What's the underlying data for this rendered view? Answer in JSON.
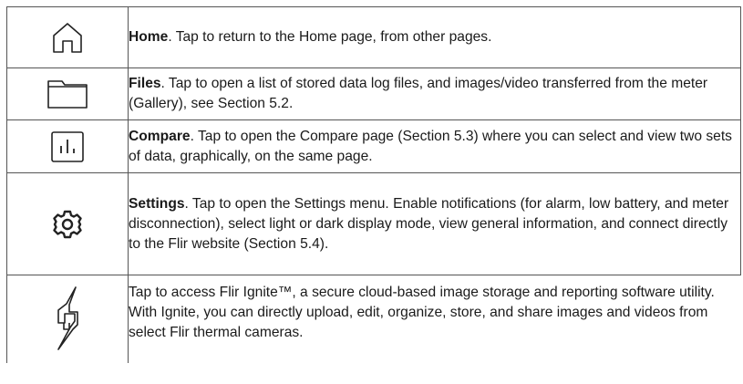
{
  "rows": [
    {
      "icon": "home-icon",
      "term": "Home",
      "text": ". Tap to return to the Home page, from other pages."
    },
    {
      "icon": "folder-icon",
      "term": "Files",
      "text": ". Tap to open a list of stored data log files, and images/video transferred from the meter (Gallery), see Section 5.2."
    },
    {
      "icon": "compare-chart-icon",
      "term": "Compare",
      "text": ". Tap to open the Compare page (Section 5.3) where you can select and view two sets of data, graphically, on the same page."
    },
    {
      "icon": "gear-icon",
      "term": "Settings",
      "text": ". Tap to open the Settings menu. Enable notifications (for alarm, low battery, and meter disconnection), select light or dark display mode, view general information, and connect directly to the Flir website (Section 5.4)."
    },
    {
      "icon": "flir-ignite-icon",
      "term": "",
      "text": "Tap to access Flir Ignite™, a secure cloud-based image storage and reporting software utility. With Ignite, you can directly upload, edit, organize, store, and share images and videos from select Flir thermal cameras."
    }
  ]
}
